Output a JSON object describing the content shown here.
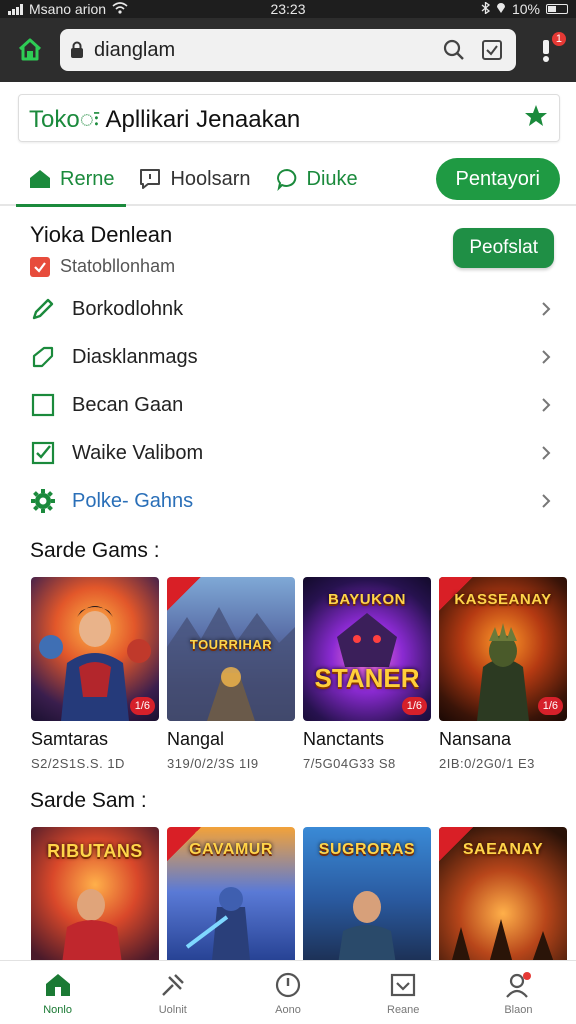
{
  "status_bar": {
    "carrier": "Msano arion",
    "time": "23:23",
    "battery": "10%"
  },
  "browser": {
    "url": "dianglam",
    "notification_count": "1"
  },
  "store": {
    "title_accent": "Tokoः",
    "title_rest": "Apllikari Jenaakan"
  },
  "tabs": [
    {
      "label": "Rerne",
      "icon": "home-icon"
    },
    {
      "label": "Hoolsarn",
      "icon": "message-icon"
    },
    {
      "label": "Diuke",
      "icon": "chat-icon"
    }
  ],
  "tab_cta": "Pentayori",
  "section": {
    "title": "Yioka Denlean",
    "status": "Statobllonham",
    "primary_button": "Peofslat"
  },
  "menu": [
    {
      "label": "Borkodlohnk",
      "icon": "pencil-icon"
    },
    {
      "label": "Diasklanmags",
      "icon": "edit-icon"
    },
    {
      "label": "Becan Gaan",
      "icon": "checkbox-empty-icon"
    },
    {
      "label": "Waike Valibom",
      "icon": "checkbox-checked-icon"
    },
    {
      "label": "Polke- Gahns",
      "icon": "gear-icon"
    }
  ],
  "games_section_1": {
    "title": "Sarde Gams :",
    "games": [
      {
        "name": "Samtaras",
        "meta": "S2/2S1S.S. 1D",
        "badge": "1/6",
        "art_title": "",
        "art_big": ""
      },
      {
        "name": "Nangal",
        "meta": "319/0/2/3S 1I9",
        "badge": "",
        "art_title": "TOURRIHAR",
        "art_big": ""
      },
      {
        "name": "Nanctants",
        "meta": "7/5G04G33 S8",
        "badge": "1/6",
        "art_title": "BAYUKON",
        "art_big": "STANER"
      },
      {
        "name": "Nansana",
        "meta": "2IB:0/2G0/1 E3",
        "badge": "1/6",
        "art_title": "KASSEANAY",
        "art_big": ""
      }
    ]
  },
  "games_section_2": {
    "title": "Sarde Sam :",
    "games": [
      {
        "art_title": "RIBUTANS"
      },
      {
        "art_title": "GAVAMUR"
      },
      {
        "art_title": "SUGRORAS"
      },
      {
        "art_title": "SAEANAY"
      }
    ]
  },
  "bottom_nav": [
    {
      "label": "Nonlo",
      "icon": "home-icon"
    },
    {
      "label": "Uolnit",
      "icon": "tools-icon"
    },
    {
      "label": "Aono",
      "icon": "clock-icon"
    },
    {
      "label": "Reane",
      "icon": "inbox-icon"
    },
    {
      "label": "Blaon",
      "icon": "profile-icon"
    }
  ],
  "colors": {
    "accent_green": "#1b8a3c",
    "badge_red": "#e53935",
    "browser_bar": "#2d2d2d"
  }
}
